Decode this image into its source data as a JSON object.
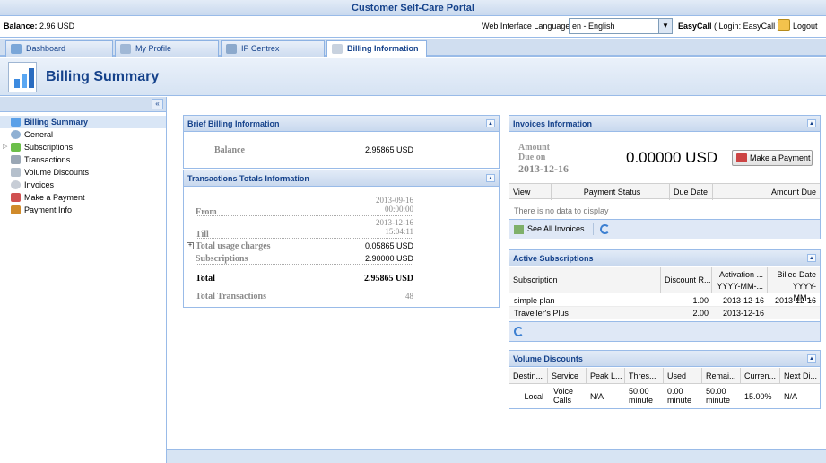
{
  "portal_title": "Customer Self-Care Portal",
  "topbar": {
    "balance_label": "Balance:",
    "balance_value": "2.96 USD",
    "language_label": "Web Interface Language:",
    "language_value": "en - English",
    "user_name": "EasyCall",
    "user_login": "( Login: EasyCall )",
    "logout_label": "Logout"
  },
  "tabs": [
    {
      "label": "Dashboard",
      "icon": "dashboard-icon"
    },
    {
      "label": "My Profile",
      "icon": "profile-icon"
    },
    {
      "label": "IP Centrex",
      "icon": "ip-centrex-icon"
    },
    {
      "label": "Billing Information",
      "icon": "billing-icon"
    }
  ],
  "header": {
    "title": "Billing Summary"
  },
  "sidebar": {
    "items": [
      {
        "label": "Billing Summary",
        "icon": "billing-summary-icon"
      },
      {
        "label": "General",
        "icon": "general-icon"
      },
      {
        "label": "Subscriptions",
        "icon": "subscriptions-icon"
      },
      {
        "label": "Transactions",
        "icon": "transactions-icon"
      },
      {
        "label": "Volume Discounts",
        "icon": "volume-discounts-icon"
      },
      {
        "label": "Invoices",
        "icon": "invoices-icon"
      },
      {
        "label": "Make a Payment",
        "icon": "payment-icon"
      },
      {
        "label": "Payment Info",
        "icon": "payment-info-icon"
      }
    ]
  },
  "brief_billing": {
    "title": "Brief Billing Information",
    "balance_label": "Balance",
    "balance_value": "2.95865 USD"
  },
  "transactions_totals": {
    "title": "Transactions Totals Information",
    "from_label": "From",
    "from_date": "2013-09-16",
    "from_time": "00:00:00",
    "till_label": "Till",
    "till_date": "2013-12-16",
    "till_time": "15:04:11",
    "usage_label": "Total usage charges",
    "usage_value": "0.05865 USD",
    "subscriptions_label": "Subscriptions",
    "subscriptions_value": "2.90000 USD",
    "total_label": "Total",
    "total_value": "2.95865 USD",
    "transactions_label": "Total Transactions",
    "transactions_value": "48"
  },
  "invoices": {
    "title": "Invoices Information",
    "amount_label": "Amount",
    "due_label": "Due on",
    "due_date": "2013-12-16",
    "amount_value": "0.00000 USD",
    "make_payment_label": "Make a Payment",
    "columns": [
      "View",
      "Payment Status",
      "Due Date",
      "Amount Due"
    ],
    "empty_text": "There is no data to display",
    "see_all_label": "See All Invoices"
  },
  "active_subscriptions": {
    "title": "Active Subscriptions",
    "columns": [
      "Subscription",
      "Discount R...",
      "Activation ...",
      "Billed Date"
    ],
    "column_sub": [
      "",
      "",
      "YYYY-MM-...",
      "YYYY-MM-..."
    ],
    "rows": [
      {
        "subscription": "simple plan",
        "discount": "1.00",
        "activation": "2013-12-16",
        "billed": "2013-12-16"
      },
      {
        "subscription": "Traveller's Plus",
        "discount": "2.00",
        "activation": "2013-12-16",
        "billed": ""
      }
    ]
  },
  "volume_discounts": {
    "title": "Volume Discounts",
    "columns": [
      "Destin...",
      "Service",
      "Peak L...",
      "Thres...",
      "Used",
      "Remai...",
      "Curren...",
      "Next Di..."
    ],
    "row": {
      "destination": "Local",
      "service_1": "Voice",
      "service_2": "Calls",
      "peak": "N/A",
      "threshold_1": "50.00",
      "threshold_2": "minute",
      "used_1": "0.00",
      "used_2": "minute",
      "remaining_1": "50.00",
      "remaining_2": "minute",
      "current": "15.00%",
      "next": "N/A"
    }
  }
}
